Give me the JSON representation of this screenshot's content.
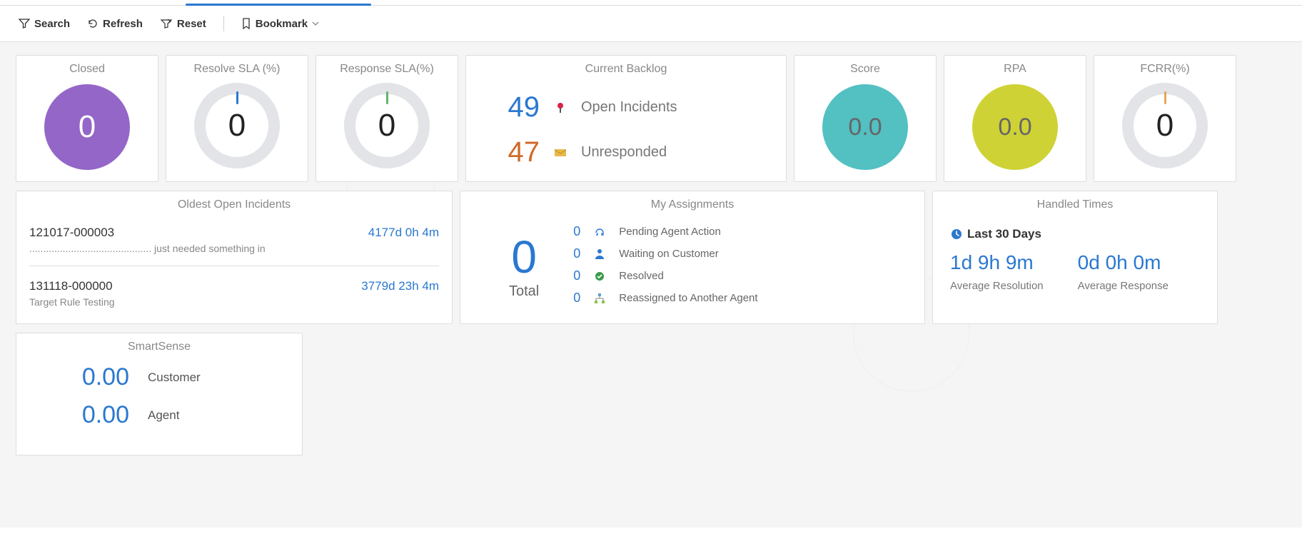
{
  "toolbar": {
    "search": "Search",
    "refresh": "Refresh",
    "reset": "Reset",
    "bookmark": "Bookmark"
  },
  "kpi": {
    "closed": {
      "title": "Closed",
      "value": "0"
    },
    "resolve": {
      "title": "Resolve SLA (%)",
      "value": "0"
    },
    "response": {
      "title": "Response SLA(%)",
      "value": "0"
    },
    "score": {
      "title": "Score",
      "value": "0.0"
    },
    "rpa": {
      "title": "RPA",
      "value": "0.0"
    },
    "fcrr": {
      "title": "FCRR(%)",
      "value": "0"
    }
  },
  "backlog": {
    "title": "Current Backlog",
    "open": {
      "count": "49",
      "label": "Open Incidents"
    },
    "unresp": {
      "count": "47",
      "label": "Unresponded"
    }
  },
  "oldest": {
    "title": "Oldest Open Incidents",
    "items": [
      {
        "id": "121017-000003",
        "age": "4177d 0h 4m",
        "desc": "............................................ just needed something in"
      },
      {
        "id": "131118-000000",
        "age": "3779d 23h 4m",
        "desc": "Target Rule Testing"
      }
    ]
  },
  "assignments": {
    "title": "My Assignments",
    "total_value": "0",
    "total_label": "Total",
    "rows": [
      {
        "count": "0",
        "label": "Pending Agent Action"
      },
      {
        "count": "0",
        "label": "Waiting on Customer"
      },
      {
        "count": "0",
        "label": "Resolved"
      },
      {
        "count": "0",
        "label": "Reassigned to Another Agent"
      }
    ]
  },
  "handled": {
    "title": "Handled Times",
    "range": "Last 30 Days",
    "resolution": {
      "value": "1d 9h 9m",
      "label": "Average Resolution"
    },
    "response": {
      "value": "0d 0h 0m",
      "label": "Average Response"
    }
  },
  "smartsense": {
    "title": "SmartSense",
    "customer": {
      "value": "0.00",
      "label": "Customer"
    },
    "agent": {
      "value": "0.00",
      "label": "Agent"
    }
  },
  "colors": {
    "purple": "#9466c8",
    "teal": "#53c0c2",
    "yellow": "#cfd235",
    "link": "#2a78d0"
  }
}
